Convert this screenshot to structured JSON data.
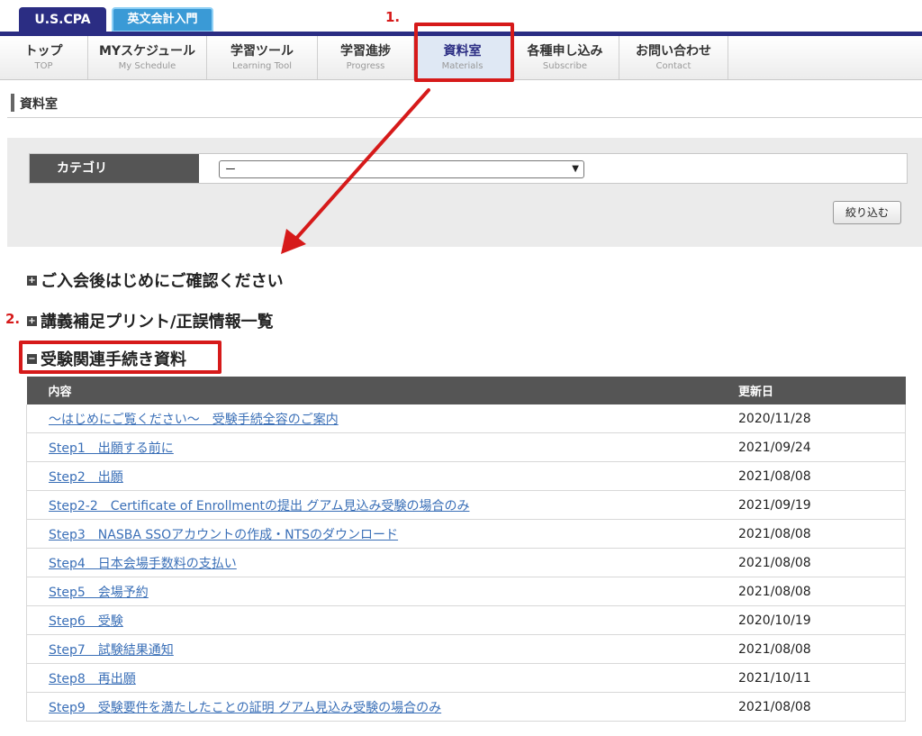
{
  "top_tabs": [
    "U.S.CPA",
    "英文会計入門"
  ],
  "nav": [
    {
      "jp": "トップ",
      "en": "TOP"
    },
    {
      "jp": "MYスケジュール",
      "en": "My Schedule"
    },
    {
      "jp": "学習ツール",
      "en": "Learning Tool"
    },
    {
      "jp": "学習進捗",
      "en": "Progress"
    },
    {
      "jp": "資料室",
      "en": "Materials"
    },
    {
      "jp": "各種申し込み",
      "en": "Subscribe"
    },
    {
      "jp": "お問い合わせ",
      "en": "Contact"
    }
  ],
  "breadcrumb": "資料室",
  "filter": {
    "label": "カテゴリ",
    "selected": "ー",
    "button": "絞り込む"
  },
  "sections": [
    {
      "icon": "plus",
      "title": "ご入会後はじめにご確認ください"
    },
    {
      "icon": "plus",
      "title": "講義補足プリント/正誤情報一覧"
    },
    {
      "icon": "minus",
      "title": "受験関連手続き資料"
    }
  ],
  "table": {
    "headers": [
      "内容",
      "更新日"
    ],
    "rows": [
      {
        "title": "～はじめにご覧ください～　受験手続全容のご案内",
        "date": "2020/11/28"
      },
      {
        "title": "Step1　出願する前に",
        "date": "2021/09/24"
      },
      {
        "title": "Step2　出願",
        "date": "2021/08/08"
      },
      {
        "title": "Step2-2　Certificate of Enrollmentの提出  グアム見込み受験の場合のみ",
        "date": "2021/09/19"
      },
      {
        "title": "Step3　NASBA SSOアカウントの作成・NTSのダウンロード",
        "date": "2021/08/08"
      },
      {
        "title": "Step4　日本会場手数料の支払い",
        "date": "2021/08/08"
      },
      {
        "title": "Step5　会場予約",
        "date": "2021/08/08"
      },
      {
        "title": "Step6　受験",
        "date": "2020/10/19"
      },
      {
        "title": "Step7　試験結果通知",
        "date": "2021/08/08"
      },
      {
        "title": "Step8　再出願",
        "date": "2021/10/11"
      },
      {
        "title": "Step9　受験要件を満たしたことの証明  グアム見込み受験の場合のみ",
        "date": "2021/08/08"
      }
    ]
  },
  "annotations": {
    "step1": "1.",
    "step2": "2."
  },
  "colors": {
    "accent_red": "#d61a1a",
    "nav_blue": "#2b2d83",
    "link": "#3a6fb7"
  }
}
